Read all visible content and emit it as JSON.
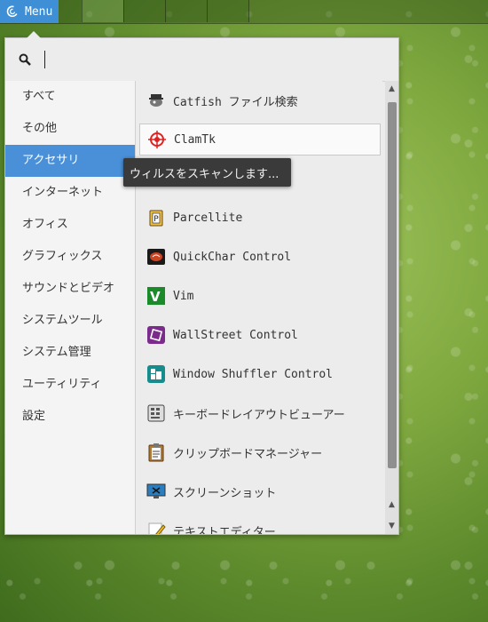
{
  "panel": {
    "menu_label": "Menu",
    "workspaces": [
      "",
      "",
      "",
      ""
    ]
  },
  "search": {
    "value": "",
    "placeholder": ""
  },
  "categories": [
    {
      "label": "すべて"
    },
    {
      "label": "その他"
    },
    {
      "label": "アクセサリ"
    },
    {
      "label": "インターネット"
    },
    {
      "label": "オフィス"
    },
    {
      "label": "グラフィックス"
    },
    {
      "label": "サウンドとビデオ"
    },
    {
      "label": "システムツール"
    },
    {
      "label": "システム管理"
    },
    {
      "label": "ユーティリティ"
    },
    {
      "label": "設定"
    }
  ],
  "active_category": "アクセサリ",
  "apps": [
    {
      "label": "Catfish ファイル検索",
      "icon": "catfish-icon"
    },
    {
      "label": "ClamTk",
      "icon": "clamtk-icon"
    },
    {
      "label": "",
      "icon": "hidden-app-icon"
    },
    {
      "label": "Parcellite",
      "icon": "parcellite-icon"
    },
    {
      "label": "QuickChar Control",
      "icon": "quickchar-icon"
    },
    {
      "label": "Vim",
      "icon": "vim-icon"
    },
    {
      "label": "WallStreet Control",
      "icon": "wallstreet-icon"
    },
    {
      "label": "Window Shuffler Control",
      "icon": "window-shuffler-icon"
    },
    {
      "label": "キーボードレイアウトビューアー",
      "icon": "keyboard-icon"
    },
    {
      "label": "クリップボードマネージャー",
      "icon": "clipboard-icon"
    },
    {
      "label": "スクリーンショット",
      "icon": "screenshot-icon"
    },
    {
      "label": "テキストエディター",
      "icon": "text-editor-icon"
    }
  ],
  "tooltip": "ウィルスをスキャンします...",
  "colors": {
    "accent": "#4a90d9",
    "menu_button": "#3f8fd6"
  }
}
